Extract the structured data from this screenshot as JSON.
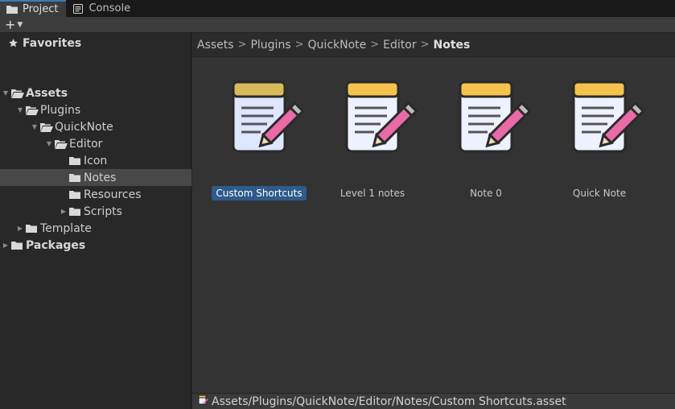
{
  "tabs": [
    {
      "label": "Project",
      "icon": "folder-icon",
      "active": true
    },
    {
      "label": "Console",
      "icon": "console-icon",
      "active": false
    }
  ],
  "toolbar": {
    "add_label": "+"
  },
  "tree": {
    "favorites": "Favorites",
    "assets": "Assets",
    "plugins": "Plugins",
    "quicknote": "QuickNote",
    "editor": "Editor",
    "icon": "Icon",
    "notes": "Notes",
    "resources": "Resources",
    "scripts": "Scripts",
    "template": "Template",
    "packages": "Packages"
  },
  "breadcrumb": {
    "items": [
      "Assets",
      "Plugins",
      "QuickNote",
      "Editor"
    ],
    "current": "Notes",
    "separator": ">"
  },
  "assets": [
    {
      "name": "Custom Shortcuts",
      "selected": true
    },
    {
      "name": "Level 1 notes",
      "selected": false
    },
    {
      "name": "Note 0",
      "selected": false
    },
    {
      "name": "Quick Note",
      "selected": false
    }
  ],
  "status": {
    "path": "Assets/Plugins/QuickNote/Editor/Notes/Custom Shortcuts.asset"
  },
  "colors": {
    "selection": "#2d5b8b",
    "tab_accent": "#3a79bb",
    "note_header": "#f4c24d",
    "note_body": "#e6ebff",
    "pencil": "#e86aa6"
  }
}
